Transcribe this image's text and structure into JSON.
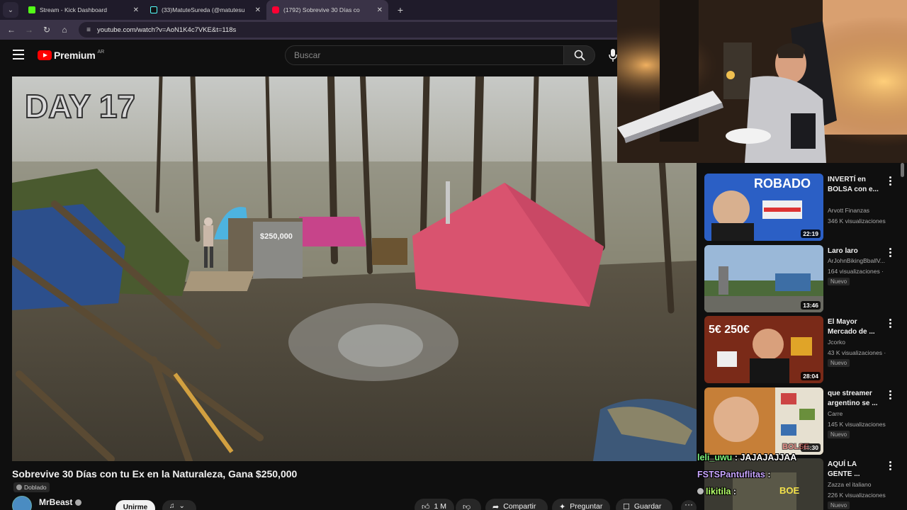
{
  "browser": {
    "tabs": [
      {
        "title": "Stream - Kick Dashboard",
        "favicon_color": "#53fc18",
        "active": false
      },
      {
        "title": "(33)MatuteSureda (@matutesu",
        "favicon_color": "#111111",
        "active": false
      },
      {
        "title": "(1792) Sobrevive 30 Días co",
        "favicon_color": "#ff0033",
        "active": true
      }
    ],
    "new_tab_label": "+",
    "url": "youtube.com/watch?v=AoN1K4c7VKE&t=118s"
  },
  "youtube": {
    "logo_text": "Premium",
    "region": "AR",
    "search_placeholder": "Buscar"
  },
  "video": {
    "overlay_day": "DAY 17",
    "box_label": "$250,000",
    "title": "Sobrevive 30 Días con tu Ex en la Naturaleza, Gana $250,000",
    "dubbed_label": "Doblado",
    "channel": "MrBeast",
    "subscribe_label": "Unirme",
    "likes": "1 M",
    "share_label": "Compartir",
    "ask_label": "Preguntar",
    "save_label": "Guardar"
  },
  "recommendations": [
    {
      "title": "INVERTÍ en BOLSA con e...",
      "channel": "Arvott Finanzas",
      "views": "346 K visualizaciones",
      "duration": "22:19",
      "badge": "",
      "thumb_text": "ROBADO"
    },
    {
      "title": "Laro laro",
      "channel": "ArJohnBikingBballV...",
      "views": "164 visualizaciones ·",
      "duration": "13:46",
      "badge": "Nuevo",
      "thumb_text": ""
    },
    {
      "title": "El Mayor Mercado de ...",
      "channel": "Jcorko",
      "views": "43 K visualizaciones ·",
      "duration": "28:04",
      "badge": "Nuevo",
      "thumb_text": "5€ 250€"
    },
    {
      "title": "que streamer argentino se ...",
      "channel": "Carre",
      "views": "145 K visualizaciones",
      "duration": "16:30",
      "badge": "Nuevo",
      "thumb_text": ""
    },
    {
      "title": "AQUÍ LA GENTE ...",
      "channel": "Zazza el italiano",
      "views": "226 K visualizaciones",
      "duration": "",
      "badge": "Nuevo",
      "thumb_text": "BOE"
    }
  ],
  "chat": [
    {
      "user": "",
      "message": "BOLSE"
    },
    {
      "user": "leli_uwu",
      "message": "JAJAJAJJAA"
    },
    {
      "user": "FSTSPantuflitas",
      "message": ""
    },
    {
      "user": "likitila",
      "message": ""
    }
  ],
  "colors": {
    "accent": "#ff0000",
    "tab_bar": "#1f1b2a",
    "address_bar": "#3a3347",
    "tent": "#d9536f"
  }
}
